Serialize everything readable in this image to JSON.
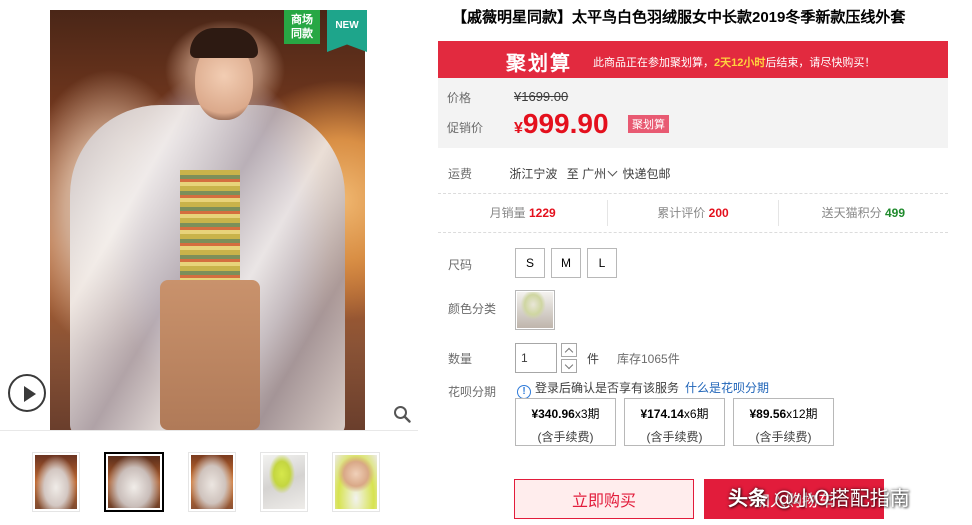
{
  "gallery": {
    "badges": {
      "mall_line1": "商场",
      "mall_line2": "同款",
      "new": "NEW"
    },
    "icons": {
      "play": "play-icon",
      "zoom": "magnifier-icon"
    },
    "thumbnail_count": 5,
    "active_thumbnail": 2
  },
  "product": {
    "title": "【戚薇明星同款】太平鸟白色羽绒服女中长款2019冬季新款压线外套"
  },
  "promo": {
    "logo": "聚划算",
    "text_before": "此商品正在参加聚划算，",
    "countdown": "2天12小时",
    "text_after": "后结束，请尽快购买！",
    "color": "#e22a3f"
  },
  "price": {
    "original_label": "价格",
    "original_value": "¥1699.00",
    "sale_label": "促销价",
    "sale_currency": "¥",
    "sale_value": "999.90",
    "tag": "聚划算",
    "sale_color": "#e4101d"
  },
  "shipping": {
    "label": "运费",
    "origin": "浙江宁波",
    "to_word": "至",
    "destination": "广州",
    "method": "快递包邮"
  },
  "stats": {
    "monthly_sales_label": "月销量",
    "monthly_sales_value": "1229",
    "reviews_label": "累计评价",
    "reviews_value": "200",
    "points_label": "送天猫积分",
    "points_value": "499"
  },
  "options": {
    "size_label": "尺码",
    "sizes": [
      "S",
      "M",
      "L"
    ],
    "color_label": "颜色分类",
    "quantity_label": "数量",
    "quantity_value": "1",
    "quantity_unit": "件",
    "stock": "库存1065件"
  },
  "installment": {
    "label": "花呗分期",
    "note": "登录后确认是否享有该服务",
    "link": "什么是花呗分期",
    "plans": [
      {
        "amount": "¥340.96",
        "period": "x3期",
        "fee": "(含手续费)"
      },
      {
        "amount": "¥174.14",
        "period": "x6期",
        "fee": "(含手续费)"
      },
      {
        "amount": "¥89.56",
        "period": "x12期",
        "fee": "(含手续费)"
      }
    ]
  },
  "actions": {
    "buy_now": "立即购买",
    "add_to_cart": "加入购物车"
  },
  "watermark": {
    "brand": "头条",
    "account": "@小O搭配指南"
  }
}
